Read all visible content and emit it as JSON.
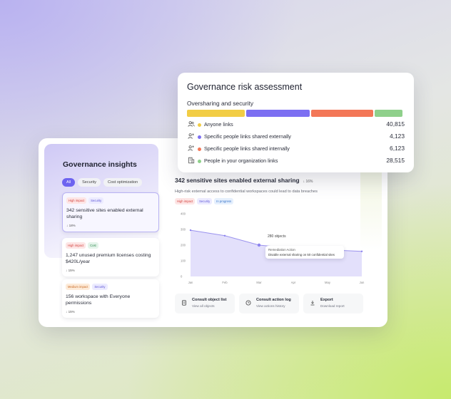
{
  "governance_insights": {
    "title": "Governance insights",
    "filters": [
      {
        "label": "All",
        "active": true
      },
      {
        "label": "Security",
        "active": false
      },
      {
        "label": "Cost optimization",
        "active": false
      }
    ],
    "cards": [
      {
        "tags": [
          "High impact",
          "Security"
        ],
        "text": "342 sensitive sites enabled external sharing",
        "delta": "↓ 18%"
      },
      {
        "tags": [
          "High impact",
          "Cost"
        ],
        "text": "1,247 unused premium licenses costing $420L/year",
        "delta": "↓ 15%"
      },
      {
        "tags": [
          "Medium impact",
          "Security"
        ],
        "text": "156 workspace with Everyone permissions",
        "delta": "↓ 15%"
      }
    ]
  },
  "detail": {
    "title": "342 sensitive sites enabled external sharing",
    "delta": "↓ 16%",
    "subtitle": "High-risk external access to confidential workspaces could lead to data breaches",
    "tags": [
      "High impact",
      "Security",
      "In progress"
    ],
    "tooltip": {
      "point_label": "280 objects",
      "line1": "Remediation Action",
      "line2": "Disable external sharing on 50 confidential sites"
    },
    "actions": [
      {
        "icon": "document-icon",
        "title": "Consult object list",
        "subtitle": "View all objects"
      },
      {
        "icon": "clock-icon",
        "title": "Consult action log",
        "subtitle": "View actions history"
      },
      {
        "icon": "download-icon",
        "title": "Export",
        "subtitle": "Download report"
      }
    ]
  },
  "chart_data": {
    "type": "area",
    "categories": [
      "Jan",
      "Feb",
      "Mar",
      "Apr",
      "May",
      "Jun"
    ],
    "values": [
      295,
      260,
      200,
      180,
      170,
      160
    ],
    "ylim": [
      0,
      400
    ],
    "yticks": [
      0,
      100,
      200,
      300,
      400
    ],
    "grid": false,
    "color": "#7b72f0"
  },
  "risk": {
    "title": "Governance risk assessment",
    "subtitle": "Oversharing and security",
    "rows": [
      {
        "icon": "people-icon",
        "label": "Anyone links",
        "value": "40,815",
        "color": "#f2cd45"
      },
      {
        "icon": "people-add-icon",
        "label": "Specific people links shared externally",
        "value": "4,123",
        "color": "#7c6ff2"
      },
      {
        "icon": "people-add-icon",
        "label": "Specific people links shared internally",
        "value": "6,123",
        "color": "#f37757"
      },
      {
        "icon": "building-icon",
        "label": "People in your organization links",
        "value": "28,515",
        "color": "#8fd08b"
      }
    ],
    "bar_segments": [
      {
        "color": "#f2cd45",
        "share": 0.27
      },
      {
        "color": "#7c6ff2",
        "share": 0.3
      },
      {
        "color": "#f37757",
        "share": 0.29
      },
      {
        "color": "#8fd08b",
        "share": 0.13
      }
    ]
  }
}
